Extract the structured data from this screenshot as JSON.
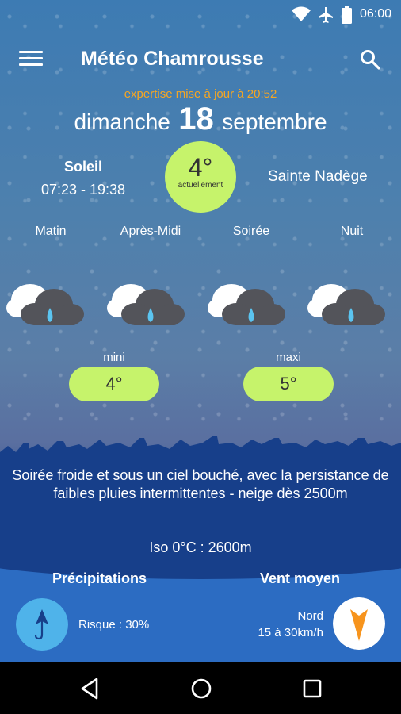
{
  "status": {
    "time": "06:00",
    "icons": [
      "wifi-icon",
      "airplane-icon",
      "battery-icon"
    ]
  },
  "appbar": {
    "title": "Météo Chamrousse",
    "menu_icon": "menu-icon",
    "search_icon": "search-icon"
  },
  "header": {
    "update_text": "expertise mise à jour à 20:52",
    "weekday": "dimanche",
    "day": "18",
    "month": "septembre"
  },
  "sun": {
    "label": "Soleil",
    "hours": "07:23 - 19:38"
  },
  "current": {
    "temp": "4°",
    "label": "actuellement"
  },
  "saint": "Sainte Nadège",
  "periods": [
    {
      "label": "Matin",
      "icon": "cloud-rain-icon"
    },
    {
      "label": "Après-Midi",
      "icon": "cloud-rain-icon"
    },
    {
      "label": "Soirée",
      "icon": "cloud-rain-icon"
    },
    {
      "label": "Nuit",
      "icon": "cloud-rain-icon"
    }
  ],
  "temps": {
    "min_label": "mini",
    "min_value": "4°",
    "max_label": "maxi",
    "max_value": "5°"
  },
  "summary": "Soirée froide et sous un ciel bouché, avec la persistance de faibles pluies intermittentes - neige dès 2500m",
  "iso": "Iso 0°C : 2600m",
  "precipitation": {
    "title": "Précipitations",
    "risk": "Risque : 30%",
    "icon": "umbrella-icon"
  },
  "wind": {
    "title": "Vent moyen",
    "direction": "Nord",
    "speed": "15 à 30km/h",
    "icon": "wind-arrow-icon"
  },
  "colors": {
    "accent_green": "#c6f36b",
    "update_orange": "#f5a623",
    "panel_blue": "#173f8a",
    "bottom_blue": "#2c6cc2",
    "wind_orange": "#f7941d",
    "umbrella_blue": "#4fb3ea"
  },
  "navigation": {
    "back": "back-icon",
    "home": "home-icon",
    "recents": "recents-icon"
  }
}
